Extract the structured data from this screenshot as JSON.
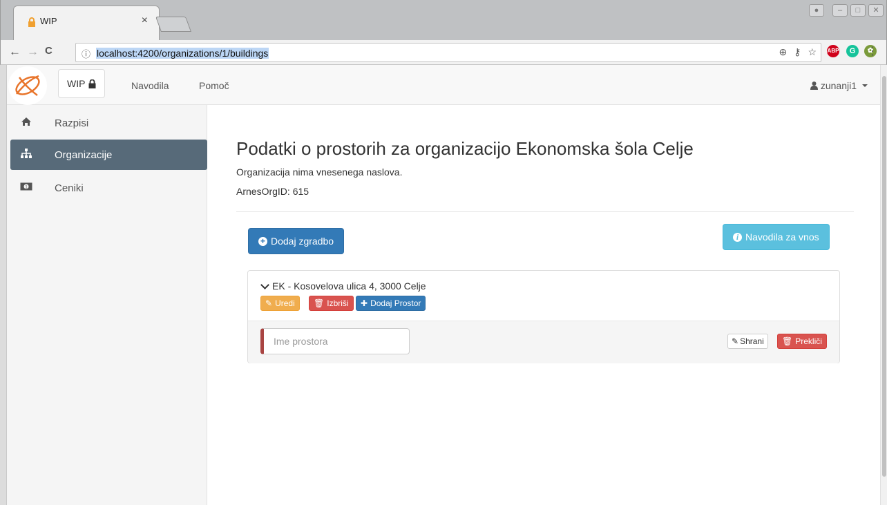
{
  "browser": {
    "tab_title": "WIP",
    "tab_close": "×",
    "url": "localhost:4200/organizations/1/buildings",
    "back": "←",
    "forward": "→",
    "reload": "C",
    "info": "ⓘ",
    "omnibox_icons": [
      "⊕",
      "⚷",
      "☆"
    ],
    "abp_label": "ABP",
    "grammarly_label": "G",
    "ext3_label": "✿",
    "menu": "⋮"
  },
  "navbar": {
    "brand": "WIP",
    "links": [
      "Navodila",
      "Pomoč"
    ],
    "user": "zunanji1"
  },
  "sidebar": {
    "items": [
      {
        "label": "Razpisi",
        "icon": "home-icon"
      },
      {
        "label": "Organizacije",
        "icon": "sitemap-icon",
        "active": true
      },
      {
        "label": "Ceniki",
        "icon": "money-icon"
      }
    ]
  },
  "main": {
    "title": "Podatki o prostorih za organizacijo Ekonomska šola Celje",
    "no_address": "Organizacija nima vnesenega naslova.",
    "arnes_id": "ArnesOrgID: 615",
    "add_building": "Dodaj zgradbo",
    "instructions": "Navodila za vnos",
    "building": {
      "name": "EK - Kosovelova ulica 4, 3000 Celje",
      "edit": "Uredi",
      "delete": "Izbriši",
      "add_room": "Dodaj Prostor"
    },
    "new_room": {
      "placeholder": "Ime prostora",
      "save": "Shrani",
      "cancel": "Prekliči"
    }
  },
  "colors": {
    "primary": "#337ab7",
    "info": "#5bc0de",
    "warning": "#f0ad4e",
    "danger": "#d9534f",
    "sidebar_active": "#576a79"
  }
}
